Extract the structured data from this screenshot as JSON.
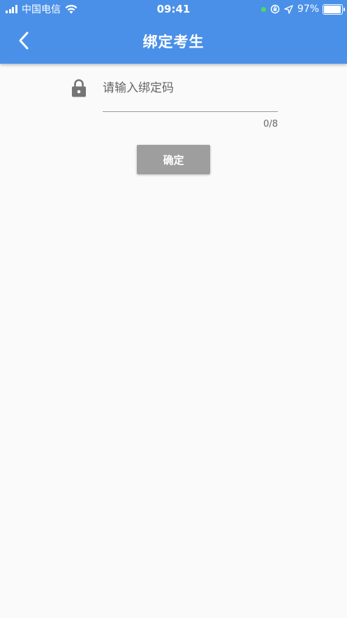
{
  "status_bar": {
    "carrier": "中国电信",
    "time": "09:41",
    "battery_percent": "97%",
    "battery_level": 0.97,
    "icons": [
      "signal-icon",
      "wifi-icon",
      "green-dot-indicator",
      "orientation-lock-icon",
      "location-icon",
      "battery-icon"
    ]
  },
  "nav": {
    "title": "绑定考生",
    "back_icon": "chevron-left-icon"
  },
  "form": {
    "lock_icon": "lock-icon",
    "input_placeholder": "请输入绑定码",
    "input_value": "",
    "counter": "0/8",
    "confirm_label": "确定"
  },
  "colors": {
    "header": "#4a90e8",
    "background": "#fafafa",
    "button": "#9e9e9e",
    "status_dot": "#4cd964"
  }
}
